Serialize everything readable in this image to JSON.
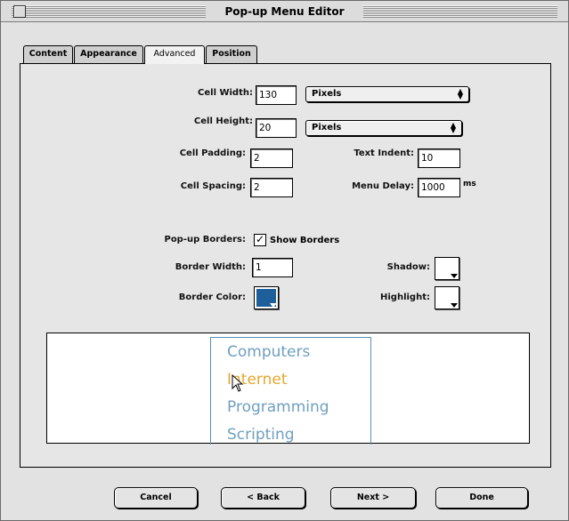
{
  "window": {
    "title": "Pop-up Menu Editor"
  },
  "tabs": [
    "Content",
    "Appearance",
    "Advanced",
    "Position"
  ],
  "active_tab": "Advanced",
  "form": {
    "cell_width": {
      "label": "Cell Width:",
      "value": "130",
      "unit": "Pixels"
    },
    "cell_height": {
      "label": "Cell Height:",
      "value": "20",
      "unit": "Pixels"
    },
    "cell_padding": {
      "label": "Cell Padding:",
      "value": "2"
    },
    "cell_spacing": {
      "label": "Cell Spacing:",
      "value": "2"
    },
    "text_indent": {
      "label": "Text Indent:",
      "value": "10"
    },
    "menu_delay": {
      "label": "Menu Delay:",
      "value": "1000",
      "unit": "ms"
    },
    "popup_borders": {
      "label": "Pop-up Borders:",
      "checkbox_label": "Show Borders",
      "checked": true,
      "check_glyph": "✓"
    },
    "border_width": {
      "label": "Border Width:",
      "value": "1"
    },
    "border_color": {
      "label": "Border Color:",
      "color": "#1f5f99"
    },
    "shadow": {
      "label": "Shadow:",
      "color": "#ffffff"
    },
    "highlight": {
      "label": "Highlight:",
      "color": "#ffffff"
    }
  },
  "preview": {
    "items": [
      "Computers",
      "Internet",
      "Programming",
      "Scripting"
    ],
    "highlighted": "Internet",
    "item_color": "#6f9fbf",
    "highlight_color": "#e3a82e"
  },
  "buttons": {
    "cancel": "Cancel",
    "back": "< Back",
    "next": "Next >",
    "done": "Done"
  }
}
